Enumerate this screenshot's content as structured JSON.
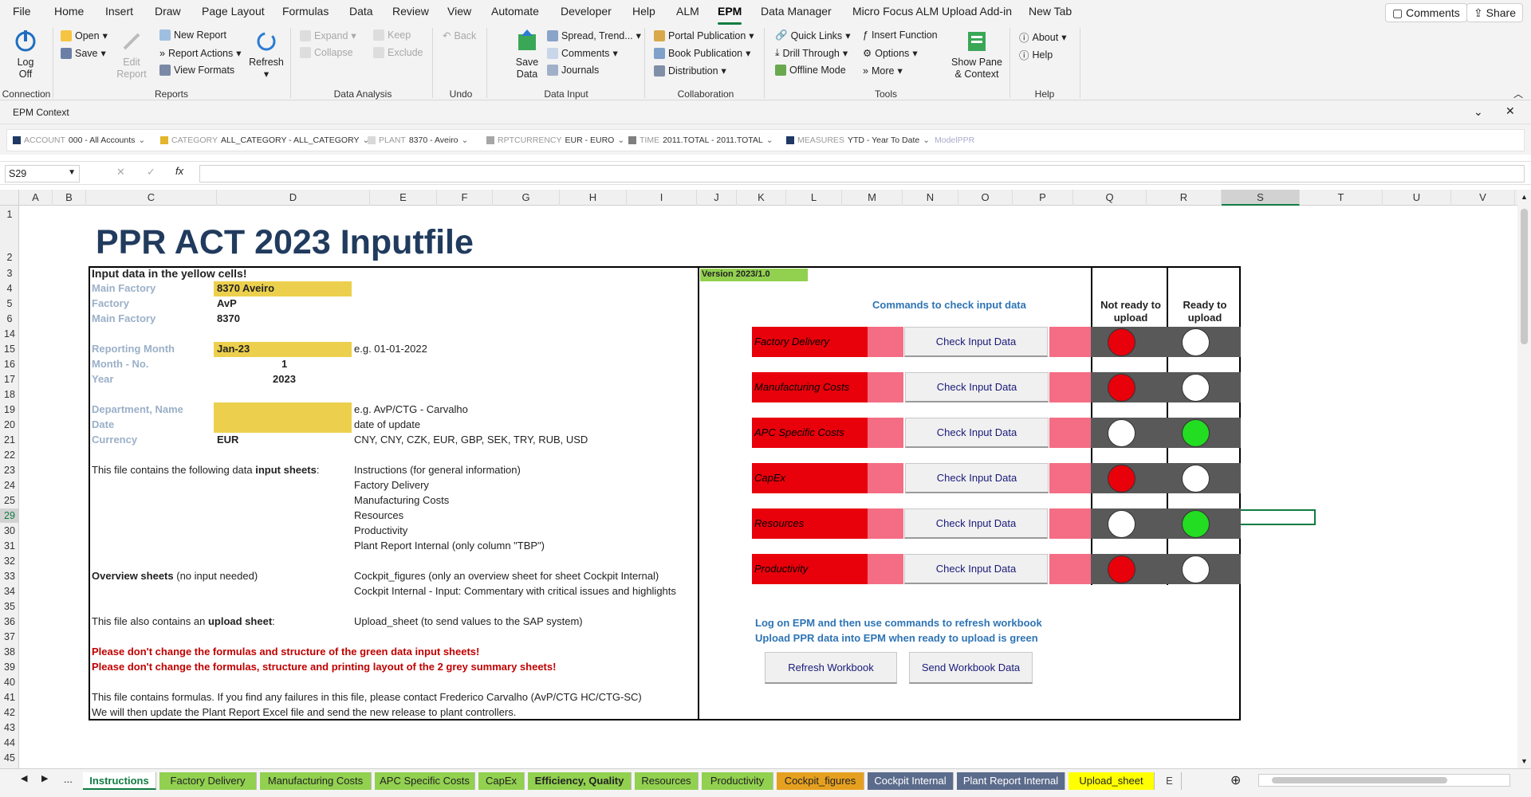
{
  "menu": {
    "tabs": [
      "File",
      "Home",
      "Insert",
      "Draw",
      "Page Layout",
      "Formulas",
      "Data",
      "Review",
      "View",
      "Automate",
      "Developer",
      "Help",
      "ALM",
      "EPM",
      "Data Manager",
      "Micro Focus ALM Upload Add-in",
      "New Tab"
    ],
    "comments": "Comments",
    "share": "Share"
  },
  "ribbon": {
    "logoff": "Log Off",
    "open": "Open",
    "save": "Save",
    "edit_report": "Edit Report",
    "new_report": "New Report",
    "report_actions": "Report Actions",
    "view_formats": "View Formats",
    "refresh": "Refresh",
    "expand": "Expand",
    "collapse": "Collapse",
    "keep": "Keep",
    "exclude": "Exclude",
    "back": "Back",
    "save_data": "Save Data",
    "spread": "Spread, Trend...",
    "comments": "Comments",
    "journals": "Journals",
    "portal_publication": "Portal Publication",
    "book_publication": "Book Publication",
    "distribution": "Distribution",
    "quick_links": "Quick Links",
    "drill_through": "Drill Through",
    "offline_mode": "Offline Mode",
    "insert_function": "Insert Function",
    "options": "Options",
    "more": "More",
    "show_pane": "Show Pane & Context",
    "about": "About",
    "help": "Help",
    "groups": {
      "connection": "Connection",
      "reports": "Reports",
      "data_analysis": "Data Analysis",
      "undo": "Undo",
      "data_input": "Data Input",
      "collaboration": "Collaboration",
      "tools": "Tools",
      "help": "Help"
    }
  },
  "epm_context": {
    "title": "EPM Context",
    "dims": [
      {
        "dim": "ACCOUNT",
        "value": "000 - All Accounts",
        "color": "#1f3864"
      },
      {
        "dim": "CATEGORY",
        "value": "ALL_CATEGORY - ALL_CATEGORY",
        "color": "#e2b52a"
      },
      {
        "dim": "PLANT",
        "value": "8370 - Aveiro",
        "color": "#d9d9d9"
      },
      {
        "dim": "RPTCURRENCY",
        "value": "EUR - EURO",
        "color": "#a6a6a6"
      },
      {
        "dim": "TIME",
        "value": "2011.TOTAL - 2011.TOTAL",
        "color": "#7f7f7f"
      },
      {
        "dim": "MEASURES",
        "value": "YTD - Year To Date",
        "color": "#1f3864"
      }
    ],
    "model": "ModelPPR"
  },
  "formula_bar": {
    "name_box": "S29",
    "formula": ""
  },
  "columns": [
    "A",
    "B",
    "C",
    "D",
    "E",
    "F",
    "G",
    "H",
    "I",
    "J",
    "K",
    "L",
    "M",
    "N",
    "O",
    "P",
    "Q",
    "R",
    "S",
    "T",
    "U",
    "V"
  ],
  "rows": [
    "1",
    "2",
    "3",
    "4",
    "5",
    "6",
    "14",
    "15",
    "16",
    "17",
    "18",
    "19",
    "20",
    "21",
    "22",
    "23",
    "24",
    "25",
    "29",
    "30",
    "31",
    "32",
    "33",
    "34",
    "35",
    "36",
    "37",
    "38",
    "39",
    "40",
    "41",
    "42",
    "43",
    "44",
    "45"
  ],
  "sheet": {
    "title": "PPR ACT 2023 Inputfile",
    "input_note": "Input data in the yellow cells!",
    "version": "Version 2023/1.0",
    "labels": {
      "main_factory": "Main Factory",
      "factory": "Factory",
      "main_factory2": "Main Factory",
      "reporting_month": "Reporting Month",
      "month_no": "Month - No.",
      "year": "Year",
      "dept": "Department, Name",
      "date": "Date",
      "currency": "Currency"
    },
    "values": {
      "main_factory": "8370 Aveiro",
      "factory": "AvP",
      "main_factory2": "8370",
      "reporting_month": "Jan-23",
      "month_no": "1",
      "year": "2023",
      "currency": "EUR"
    },
    "hints": {
      "reporting_month": "e.g. 01-01-2022",
      "dept": "e.g. AvP/CTG - Carvalho",
      "date": "date of update",
      "currency": "CNY, CNY, CZK, EUR, GBP, SEK, TRY, RUB, USD"
    },
    "input_sheets_intro_a": "This file contains the following data ",
    "input_sheets_intro_b": "input sheets",
    "input_sheets_intro_c": ":",
    "input_sheets": [
      "Instructions (for general information)",
      "Factory Delivery",
      "Manufacturing Costs",
      "Resources",
      "Productivity",
      "Plant Report Internal (only column \"TBP\")"
    ],
    "overview_a": "Overview sheets",
    "overview_b": " (no input needed)",
    "overview_items": [
      "Cockpit_figures (only an overview sheet for sheet Cockpit Internal)",
      "Cockpit Internal - Input: Commentary with critical issues and highlights"
    ],
    "upload_a": "This file also contains an ",
    "upload_b": "upload sheet",
    "upload_c": ":",
    "upload_item": "Upload_sheet (to send values to the SAP system)",
    "warn1": "Please don't change the formulas and structure of the green data input sheets!",
    "warn2": "Please don't change the formulas, structure and printing layout of the 2 grey summary sheets!",
    "contact1": "This file contains formulas. If you find any failures in this file, please contact Frederico Carvalho (AvP/CTG HC/CTG-SC)",
    "contact2": "We will then update the Plant Report Excel file and send the new release to plant controllers.",
    "commands_title": "Commands to check input data",
    "not_ready": "Not ready to upload",
    "ready": "Ready to upload",
    "check_label": "Check Input Data",
    "commands": [
      {
        "name": "Factory Delivery",
        "status": "not_ready"
      },
      {
        "name": "Manufacturing Costs",
        "status": "not_ready"
      },
      {
        "name": "APC Specific Costs",
        "status": "ready"
      },
      {
        "name": "CapEx",
        "status": "not_ready"
      },
      {
        "name": "Resources",
        "status": "ready"
      },
      {
        "name": "Productivity",
        "status": "not_ready"
      }
    ],
    "epm_note1": "Log on EPM and then use commands to refresh workbook",
    "epm_note2": "Upload PPR data into EPM when ready to upload is green",
    "refresh_btn": "Refresh Workbook",
    "send_btn": "Send Workbook Data",
    "colors": {
      "red_light": "#e8000b",
      "green_light": "#22dd22",
      "yellow_cell": "#ecd04d",
      "version_bg": "#92d050"
    }
  },
  "sheet_tabs": [
    {
      "name": "Instructions",
      "color": "#ffffff",
      "text": "#107c41"
    },
    {
      "name": "Factory Delivery",
      "color": "#92d050",
      "text": "#222"
    },
    {
      "name": "Manufacturing Costs",
      "color": "#92d050",
      "text": "#222"
    },
    {
      "name": "APC Specific Costs",
      "color": "#92d050",
      "text": "#222"
    },
    {
      "name": "CapEx",
      "color": "#92d050",
      "text": "#222"
    },
    {
      "name": "Efficiency, Quality",
      "color": "#92d050",
      "text": "#222"
    },
    {
      "name": "Resources",
      "color": "#92d050",
      "text": "#222"
    },
    {
      "name": "Productivity",
      "color": "#92d050",
      "text": "#222"
    },
    {
      "name": "Cockpit_figures",
      "color": "#e6a020",
      "text": "#222"
    },
    {
      "name": "Cockpit Internal",
      "color": "#5b6b8c",
      "text": "#fff"
    },
    {
      "name": "Plant Report Internal",
      "color": "#5b6b8c",
      "text": "#fff"
    },
    {
      "name": "Upload_sheet",
      "color": "#ffff00",
      "text": "#222"
    },
    {
      "name": "E",
      "color": "#f3f3f3",
      "text": "#444"
    }
  ],
  "sheet_nav": {
    "ellipsis": "..."
  }
}
